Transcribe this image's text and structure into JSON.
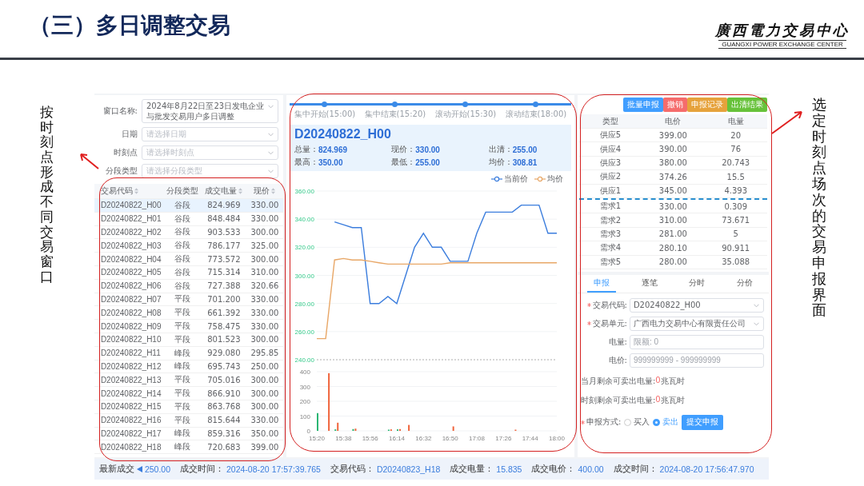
{
  "slide": {
    "title": "（三）多日调整交易",
    "logo_name": "廣西電力交易中心",
    "logo_subtitle": "GUANGXI POWER EXCHANGE CENTER",
    "left_note": "按时刻点形成不同交易窗口",
    "right_note": "选定时刻点场次的交易申报界面"
  },
  "filters": [
    {
      "label": "窗口名称:",
      "value": "2024年8月22日至23日发电企业与批发交易用户多日调整"
    },
    {
      "label": "日期",
      "placeholder": "请选择日期"
    },
    {
      "label": "时刻点",
      "placeholder": "请选择时刻点"
    },
    {
      "label": "分段类型",
      "placeholder": "请选择分段类型"
    }
  ],
  "window_table": {
    "columns": [
      {
        "label": "交易代码",
        "sortable": true
      },
      {
        "label": "分段类型",
        "sortable": false
      },
      {
        "label": "成交电量",
        "sortable": true
      },
      {
        "label": "现价",
        "sortable": true
      }
    ],
    "rows": [
      {
        "selected": true,
        "cells": [
          "D20240822_H00",
          "谷段",
          "824.969",
          "330.00"
        ]
      },
      {
        "selected": false,
        "cells": [
          "D20240822_H01",
          "谷段",
          "848.484",
          "330.00"
        ]
      },
      {
        "selected": false,
        "cells": [
          "D20240822_H02",
          "谷段",
          "903.533",
          "300.00"
        ]
      },
      {
        "selected": false,
        "cells": [
          "D20240822_H03",
          "谷段",
          "786.177",
          "325.00"
        ]
      },
      {
        "selected": false,
        "cells": [
          "D20240822_H04",
          "谷段",
          "773.572",
          "300.00"
        ]
      },
      {
        "selected": false,
        "cells": [
          "D20240822_H05",
          "谷段",
          "715.314",
          "310.00"
        ]
      },
      {
        "selected": false,
        "cells": [
          "D20240822_H06",
          "谷段",
          "727.388",
          "320.66"
        ]
      },
      {
        "selected": false,
        "cells": [
          "D20240822_H07",
          "平段",
          "701.200",
          "330.00"
        ]
      },
      {
        "selected": false,
        "cells": [
          "D20240822_H08",
          "平段",
          "661.392",
          "330.00"
        ]
      },
      {
        "selected": false,
        "cells": [
          "D20240822_H09",
          "平段",
          "758.475",
          "330.00"
        ]
      },
      {
        "selected": false,
        "cells": [
          "D20240822_H10",
          "平段",
          "801.523",
          "300.00"
        ]
      },
      {
        "selected": false,
        "cells": [
          "D20240822_H11",
          "峰段",
          "929.080",
          "295.85"
        ]
      },
      {
        "selected": false,
        "cells": [
          "D20240822_H12",
          "峰段",
          "695.743",
          "250.00"
        ]
      },
      {
        "selected": false,
        "cells": [
          "D20240822_H13",
          "平段",
          "705.016",
          "300.00"
        ]
      },
      {
        "selected": false,
        "cells": [
          "D20240822_H14",
          "平段",
          "866.910",
          "300.00"
        ]
      },
      {
        "selected": false,
        "cells": [
          "D20240822_H15",
          "平段",
          "863.768",
          "300.00"
        ]
      },
      {
        "selected": false,
        "cells": [
          "D20240822_H16",
          "平段",
          "815.644",
          "330.00"
        ]
      },
      {
        "selected": false,
        "cells": [
          "D20240822_H17",
          "峰段",
          "859.316",
          "350.00"
        ]
      },
      {
        "selected": false,
        "cells": [
          "D20240822_H18",
          "峰段",
          "720.683",
          "399.00"
        ]
      }
    ]
  },
  "steps": [
    "集中开始(15:00)",
    "集中结束(15:20)",
    "滚动开始(15:30)",
    "滚动结束(18:00)"
  ],
  "contract": {
    "code": "D20240822_H00",
    "stats": [
      {
        "label": "总量：",
        "value": "824.969"
      },
      {
        "label": "现价：",
        "value": "330.00"
      },
      {
        "label": "出清：",
        "value": "255.00"
      },
      {
        "label": "最高：",
        "value": "350.00"
      },
      {
        "label": "最低：",
        "value": "255.00"
      },
      {
        "label": "均价：",
        "value": "308.81"
      }
    ]
  },
  "price_chart": {
    "chart_data": {
      "type": "line",
      "categories": [
        null,
        null,
        null,
        null,
        null,
        null,
        null,
        null,
        null,
        null,
        null,
        null,
        null,
        null,
        null,
        null,
        null,
        null,
        null,
        null,
        null,
        null,
        null,
        null,
        null,
        null,
        null,
        null
      ],
      "series": [
        {
          "name": "当前价",
          "color": "#3b7ddd",
          "values": [
            null,
            null,
            338,
            336,
            334,
            334,
            280,
            280,
            285,
            280,
            300,
            320,
            330,
            320,
            320,
            310,
            310,
            310,
            330,
            345,
            345,
            345,
            345,
            350,
            350,
            350,
            330,
            330
          ]
        },
        {
          "name": "均价",
          "color": "#e8a767",
          "values": [
            255,
            255,
            311,
            312,
            311,
            311,
            310,
            309,
            308,
            308,
            308,
            308,
            308,
            308,
            308,
            309,
            309,
            309,
            309,
            309,
            309,
            309,
            309,
            309,
            309,
            309,
            309,
            309
          ]
        }
      ],
      "grid": true,
      "ylim": [
        240,
        360
      ],
      "yticks": [
        {
          "value": 240,
          "label": "240.00"
        },
        {
          "value": 260,
          "label": "260.00"
        },
        {
          "value": 280,
          "label": "280.00"
        },
        {
          "value": 300,
          "label": "300.00"
        },
        {
          "value": 320,
          "label": "320.00"
        },
        {
          "value": 340,
          "label": "340.00"
        },
        {
          "value": 360,
          "label": "360.00"
        }
      ]
    }
  },
  "volume_chart": {
    "chart_data": {
      "type": "bar",
      "categories": [
        "15:20",
        null,
        null,
        "15:38",
        null,
        null,
        "15:56",
        null,
        null,
        "16:14",
        null,
        null,
        "16:32",
        null,
        null,
        "16:50",
        null,
        null,
        "17:08",
        null,
        null,
        "17:26",
        null,
        null,
        "17:44",
        null,
        null,
        "18:00"
      ],
      "series": [
        {
          "color": "#2bb673",
          "values": [
            120,
            null,
            10,
            null,
            12,
            null,
            null,
            null,
            8,
            10,
            null,
            null,
            null,
            null,
            null,
            null,
            null,
            null,
            null,
            null,
            null,
            null,
            null,
            null,
            null,
            null,
            null,
            null
          ]
        },
        {
          "color": "#f0643c",
          "values": [
            null,
            390,
            55,
            null,
            15,
            null,
            null,
            null,
            10,
            12,
            40,
            null,
            null,
            null,
            null,
            30,
            null,
            null,
            null,
            null,
            null,
            null,
            8,
            null,
            null,
            null,
            null,
            null
          ]
        }
      ],
      "grid": true,
      "ylim": [
        0,
        400
      ],
      "yticks": [
        0,
        100,
        200,
        300,
        400
      ]
    }
  },
  "action_buttons": [
    {
      "label": "批量申报",
      "color": "#409eff"
    },
    {
      "label": "撤销",
      "color": "#f56c6c"
    },
    {
      "label": "申报记录",
      "color": "#e6a23c"
    },
    {
      "label": "出清结果",
      "color": "#67c23a"
    }
  ],
  "order_book": {
    "columns": [
      "类型",
      "电价",
      "电量"
    ],
    "supply": [
      [
        "供应5",
        "399.00",
        "20"
      ],
      [
        "供应4",
        "390.00",
        "76"
      ],
      [
        "供应3",
        "380.00",
        "20.743"
      ],
      [
        "供应2",
        "374.26",
        "15.5"
      ],
      [
        "供应1",
        "345.00",
        "4.393"
      ]
    ],
    "demand": [
      [
        "需求1",
        "330.00",
        "0.309"
      ],
      [
        "需求2",
        "310.00",
        "73.671"
      ],
      [
        "需求3",
        "281.00",
        "5"
      ],
      [
        "需求4",
        "280.10",
        "90.911"
      ],
      [
        "需求5",
        "280.00",
        "35.088"
      ]
    ]
  },
  "tabs": [
    {
      "label": "申报",
      "selected": true
    },
    {
      "label": "逐笔",
      "selected": false
    },
    {
      "label": "分时",
      "selected": false
    },
    {
      "label": "分价",
      "selected": false
    }
  ],
  "form": [
    {
      "kind": "select",
      "label": "交易代码:",
      "required": true,
      "value": "D20240822_H00"
    },
    {
      "kind": "select",
      "label": "交易单元:",
      "required": true,
      "value": "广西电力交易中心有限责任公司"
    },
    {
      "kind": "input",
      "label": "电量:",
      "required": false,
      "placeholder": "限额: 0"
    },
    {
      "kind": "input",
      "label": "电价:",
      "required": false,
      "placeholder": "999999999 - 999999999"
    }
  ],
  "limits": [
    {
      "label": "当月剩余可卖出电量:",
      "value": "0",
      "unit": "兆瓦时"
    },
    {
      "label": "时刻剩余可卖出电量:",
      "value": "0",
      "unit": "兆瓦时"
    }
  ],
  "mode": {
    "label": "申报方式:",
    "required": true,
    "options": [
      {
        "label": "买入",
        "selected": false
      },
      {
        "label": "卖出",
        "selected": true
      }
    ],
    "submit": "提交申报"
  },
  "ticker": [
    {
      "label": "最新成交",
      "value": "250.00"
    },
    {
      "label": "成交时间：",
      "value": "2024-08-20 17:57:39.765"
    },
    {
      "label": "交易代码：",
      "value": "D20240823_H18"
    },
    {
      "label": "成交电量：",
      "value": "15.835"
    },
    {
      "label": "成交电价：",
      "value": "400.00"
    },
    {
      "label": "成交时间：",
      "value": "2024-08-20 17:56:47.970"
    }
  ]
}
